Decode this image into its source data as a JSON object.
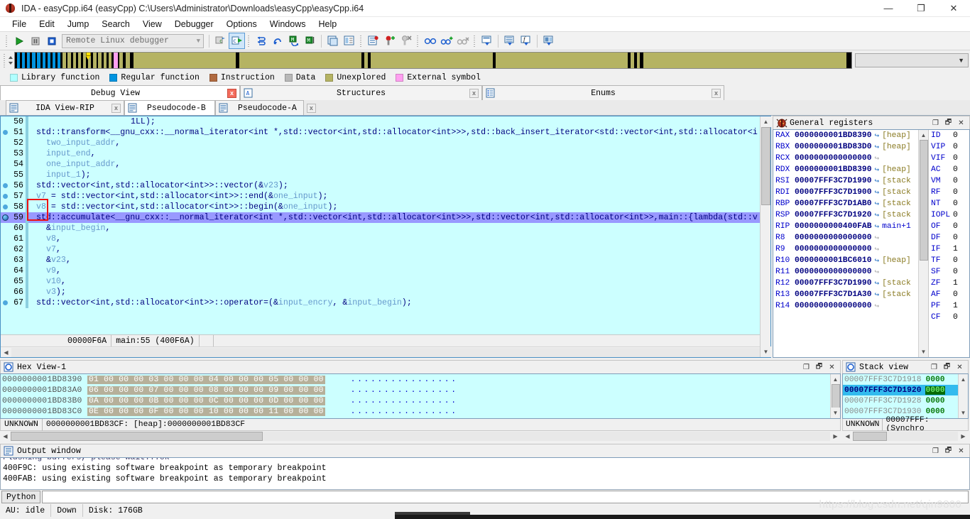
{
  "window": {
    "title": "IDA - easyCpp.i64 (easyCpp) C:\\Users\\Administrator\\Downloads\\easyCpp\\easyCpp.i64",
    "icon": "ida-bug-icon",
    "minimize": "—",
    "maximize": "❐",
    "close": "✕"
  },
  "menu": [
    "File",
    "Edit",
    "Jump",
    "Search",
    "View",
    "Debugger",
    "Options",
    "Windows",
    "Help"
  ],
  "toolbar": {
    "debugger_selector": "Remote Linux debugger",
    "dropdown_arrow": "▼"
  },
  "navband": {
    "combo_value": "",
    "combo_arrow": "▼"
  },
  "legend": [
    {
      "label": "Library function",
      "color": "#b0ffff"
    },
    {
      "label": "Regular function",
      "color": "#0094e0"
    },
    {
      "label": "Instruction",
      "color": "#b06a40"
    },
    {
      "label": "Data",
      "color": "#b8b8b8"
    },
    {
      "label": "Unexplored",
      "color": "#b5b363"
    },
    {
      "label": "External symbol",
      "color": "#ff9ff0"
    }
  ],
  "tabs_top": [
    {
      "label": "Debug View",
      "active": true,
      "close": "x",
      "close_red": true,
      "icon": "none"
    },
    {
      "label": "Structures",
      "active": false,
      "close": "x",
      "close_red": false,
      "icon": "struct-icon"
    },
    {
      "label": "Enums",
      "active": false,
      "close": "x",
      "close_red": false,
      "icon": "enum-icon"
    }
  ],
  "tabs_bottom": [
    {
      "label": "IDA View-RIP",
      "active": false,
      "close": "x",
      "close_red": false,
      "icon": "doc-icon"
    },
    {
      "label": "Pseudocode-B",
      "active": true,
      "close": "x",
      "close_red": true,
      "icon": "doc-icon"
    },
    {
      "label": "Pseudocode-A",
      "active": false,
      "close": "x",
      "close_red": false,
      "icon": "doc-icon"
    }
  ],
  "pseudocode": {
    "status_address": "00000F6A",
    "status_symbol": "main:55 (400F6A)",
    "lines": [
      {
        "n": "50",
        "bp": false,
        "cur": false,
        "hl": false,
        "indent": 20,
        "text": "1LL);"
      },
      {
        "n": "51",
        "bp": true,
        "cur": false,
        "hl": false,
        "indent": 1,
        "text": "std::transform<__gnu_cxx::__normal_iterator<int *,std::vector<int,std::allocator<int>>>,std::back_insert_iterator<std::vector<int,std::allocator<i"
      },
      {
        "n": "52",
        "bp": false,
        "cur": false,
        "hl": false,
        "indent": 3,
        "text": "two_input_addr,"
      },
      {
        "n": "53",
        "bp": false,
        "cur": false,
        "hl": false,
        "indent": 3,
        "text": "input_end,"
      },
      {
        "n": "54",
        "bp": false,
        "cur": false,
        "hl": false,
        "indent": 3,
        "text": "one_input_addr,"
      },
      {
        "n": "55",
        "bp": false,
        "cur": false,
        "hl": false,
        "indent": 3,
        "text": "input_1);"
      },
      {
        "n": "56",
        "bp": true,
        "cur": false,
        "hl": false,
        "indent": 1,
        "text": "std::vector<int,std::allocator<int>>::vector(&v23);"
      },
      {
        "n": "57",
        "bp": true,
        "cur": false,
        "hl": false,
        "indent": 1,
        "text": "v7 = std::vector<int,std::allocator<int>>::end(&one_input);"
      },
      {
        "n": "58",
        "bp": true,
        "cur": false,
        "hl": false,
        "indent": 1,
        "text": "v8 = std::vector<int,std::allocator<int>>::begin(&one_input);"
      },
      {
        "n": "59",
        "bp": false,
        "cur": true,
        "hl": true,
        "indent": 1,
        "text": "std::accumulate<__gnu_cxx::__normal_iterator<int *,std::vector<int,std::allocator<int>>>,std::vector<int,std::allocator<int>>,main::{lambda(std::v"
      },
      {
        "n": "60",
        "bp": false,
        "cur": false,
        "hl": false,
        "indent": 3,
        "text": "&input_begin,"
      },
      {
        "n": "61",
        "bp": false,
        "cur": false,
        "hl": false,
        "indent": 3,
        "text": "v8,"
      },
      {
        "n": "62",
        "bp": false,
        "cur": false,
        "hl": false,
        "indent": 3,
        "text": "v7,"
      },
      {
        "n": "63",
        "bp": false,
        "cur": false,
        "hl": false,
        "indent": 3,
        "text": "&v23,"
      },
      {
        "n": "64",
        "bp": false,
        "cur": false,
        "hl": false,
        "indent": 3,
        "text": "v9,"
      },
      {
        "n": "65",
        "bp": false,
        "cur": false,
        "hl": false,
        "indent": 3,
        "text": "v10,"
      },
      {
        "n": "66",
        "bp": false,
        "cur": false,
        "hl": false,
        "indent": 3,
        "text": "v3);"
      },
      {
        "n": "67",
        "bp": true,
        "cur": false,
        "hl": false,
        "indent": 1,
        "text": "std::vector<int,std::allocator<int>>::operator=(&input_encry, &input_begin);"
      }
    ]
  },
  "registers": {
    "title": "General registers",
    "icon": "bug-icon",
    "rows": [
      {
        "name": "RAX",
        "value": "0000000001BD8390",
        "arrow": true,
        "tag": "[heap]",
        "tagtype": "heap"
      },
      {
        "name": "RBX",
        "value": "0000000001BD83D0",
        "arrow": true,
        "tag": "[heap]",
        "tagtype": "heap"
      },
      {
        "name": "RCX",
        "value": "0000000000000000",
        "arrow": false,
        "tag": "",
        "tagtype": ""
      },
      {
        "name": "RDX",
        "value": "0000000001BD8390",
        "arrow": true,
        "tag": "[heap]",
        "tagtype": "heap"
      },
      {
        "name": "RSI",
        "value": "00007FFF3C7D1990",
        "arrow": true,
        "tag": "[stack",
        "tagtype": "stack"
      },
      {
        "name": "RDI",
        "value": "00007FFF3C7D1900",
        "arrow": true,
        "tag": "[stack",
        "tagtype": "stack"
      },
      {
        "name": "RBP",
        "value": "00007FFF3C7D1AB0",
        "arrow": true,
        "tag": "[stack",
        "tagtype": "stack"
      },
      {
        "name": "RSP",
        "value": "00007FFF3C7D1920",
        "arrow": true,
        "tag": "[stack",
        "tagtype": "stack"
      },
      {
        "name": "RIP",
        "value": "0000000000400FAB",
        "arrow": true,
        "tag": "main+1",
        "tagtype": "main"
      },
      {
        "name": "R8",
        "value": "0000000000000000",
        "arrow": false,
        "tag": "",
        "tagtype": ""
      },
      {
        "name": "R9",
        "value": "0000000000000000",
        "arrow": false,
        "tag": "",
        "tagtype": ""
      },
      {
        "name": "R10",
        "value": "0000000001BC6010",
        "arrow": true,
        "tag": "[heap]",
        "tagtype": "heap"
      },
      {
        "name": "R11",
        "value": "0000000000000000",
        "arrow": false,
        "tag": "",
        "tagtype": ""
      },
      {
        "name": "R12",
        "value": "00007FFF3C7D1990",
        "arrow": true,
        "tag": "[stack",
        "tagtype": "stack"
      },
      {
        "name": "R13",
        "value": "00007FFF3C7D1A30",
        "arrow": true,
        "tag": "[stack",
        "tagtype": "stack"
      },
      {
        "name": "R14",
        "value": "0000000000000000",
        "arrow": false,
        "tag": "",
        "tagtype": ""
      }
    ],
    "flags": [
      {
        "name": "ID",
        "value": "0"
      },
      {
        "name": "VIP",
        "value": "0"
      },
      {
        "name": "VIF",
        "value": "0"
      },
      {
        "name": "AC",
        "value": "0"
      },
      {
        "name": "VM",
        "value": "0"
      },
      {
        "name": "RF",
        "value": "0"
      },
      {
        "name": "NT",
        "value": "0"
      },
      {
        "name": "IOPL",
        "value": "0"
      },
      {
        "name": "OF",
        "value": "0"
      },
      {
        "name": "DF",
        "value": "0"
      },
      {
        "name": "IF",
        "value": "1"
      },
      {
        "name": "TF",
        "value": "0"
      },
      {
        "name": "SF",
        "value": "0"
      },
      {
        "name": "ZF",
        "value": "1"
      },
      {
        "name": "AF",
        "value": "0"
      },
      {
        "name": "PF",
        "value": "1"
      },
      {
        "name": "CF",
        "value": "0"
      }
    ]
  },
  "hexview": {
    "title": "Hex View-1",
    "icon": "hex-icon",
    "rows": [
      {
        "addr": "0000000001BD8390",
        "bytes": "01 00 00 00 03 00 00 00  04 00 00 00 05 00 00 00",
        "ascii": "................"
      },
      {
        "addr": "0000000001BD83A0",
        "bytes": "06 00 00 00 07 00 00 00  08 00 00 00 09 00 00 00",
        "ascii": "................"
      },
      {
        "addr": "0000000001BD83B0",
        "bytes": "0A 00 00 00 0B 00 00 00  0C 00 00 00 0D 00 00 00",
        "ascii": "................"
      },
      {
        "addr": "0000000001BD83C0",
        "bytes": "0E 00 00 00 0F 00 00 00  10 00 00 00 11 00 00 00",
        "ascii": "................"
      }
    ],
    "status_type": "UNKNOWN",
    "status_addr": "0000000001BD83CF: [heap]:0000000001BD83CF"
  },
  "stackview": {
    "title": "Stack view",
    "icon": "hex-icon",
    "rows": [
      {
        "addr": "00007FFF3C7D1918",
        "value": "0000",
        "sel": false
      },
      {
        "addr": "00007FFF3C7D1920",
        "value": "0000",
        "sel": true
      },
      {
        "addr": "00007FFF3C7D1928",
        "value": "0000",
        "sel": false
      },
      {
        "addr": "00007FFF3C7D1930",
        "value": "0000",
        "sel": false
      }
    ],
    "status_type": "UNKNOWN",
    "status_addr": "00007FFF: (Synchro"
  },
  "output": {
    "title": "Output window",
    "icon": "output-icon",
    "lines": [
      "Flushing buffers, please wait...ok",
      "400F9C: using existing software breakpoint as temporary breakpoint",
      "400FAB: using existing software breakpoint as temporary breakpoint"
    ],
    "python_button": "Python",
    "python_input": ""
  },
  "statusbar": {
    "au": "AU: idle",
    "down": "Down",
    "disk": "Disk: 176GB"
  },
  "watermark": "https://blog.csdn.net/qin9800"
}
